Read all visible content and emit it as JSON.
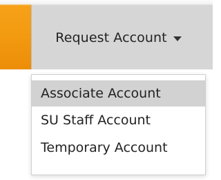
{
  "colors": {
    "accent": "#f39c12",
    "button_background": "#d6d6d6",
    "highlight": "#d2d2d2",
    "text": "#222222"
  },
  "dropdown": {
    "label": "Request Account",
    "icon": "caret-down-icon",
    "expanded": true,
    "items": [
      {
        "label": "Associate Account",
        "highlighted": true
      },
      {
        "label": "SU Staff Account",
        "highlighted": false
      },
      {
        "label": "Temporary Account",
        "highlighted": false
      }
    ]
  }
}
